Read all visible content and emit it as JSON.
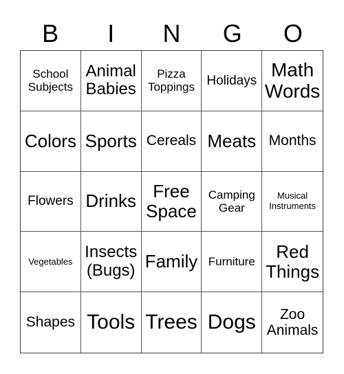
{
  "header": {
    "letters": [
      "B",
      "I",
      "N",
      "G",
      "O"
    ]
  },
  "cells": [
    {
      "text": "School\nSubjects",
      "size": "s17"
    },
    {
      "text": "Animal\nBabies",
      "size": "s24"
    },
    {
      "text": "Pizza\nToppings",
      "size": "s17"
    },
    {
      "text": "Holidays",
      "size": "s19"
    },
    {
      "text": "Math\nWords",
      "size": "s28"
    },
    {
      "text": "Colors",
      "size": "s26"
    },
    {
      "text": "Sports",
      "size": "s26"
    },
    {
      "text": "Cereals",
      "size": "s21"
    },
    {
      "text": "Meats",
      "size": "s26"
    },
    {
      "text": "Months",
      "size": "s21"
    },
    {
      "text": "Flowers",
      "size": "s19"
    },
    {
      "text": "Drinks",
      "size": "s26"
    },
    {
      "text": "Free\nSpace",
      "size": "s26"
    },
    {
      "text": "Camping\nGear",
      "size": "s17"
    },
    {
      "text": "Musical\nInstruments",
      "size": "s13"
    },
    {
      "text": "Vegetables",
      "size": "s13"
    },
    {
      "text": "Insects\n(Bugs)",
      "size": "s24"
    },
    {
      "text": "Family",
      "size": "s26"
    },
    {
      "text": "Furniture",
      "size": "s17"
    },
    {
      "text": "Red\nThings",
      "size": "s26"
    },
    {
      "text": "Shapes",
      "size": "s21"
    },
    {
      "text": "Tools",
      "size": "s30"
    },
    {
      "text": "Trees",
      "size": "s30"
    },
    {
      "text": "Dogs",
      "size": "s30"
    },
    {
      "text": "Zoo\nAnimals",
      "size": "s21"
    }
  ]
}
